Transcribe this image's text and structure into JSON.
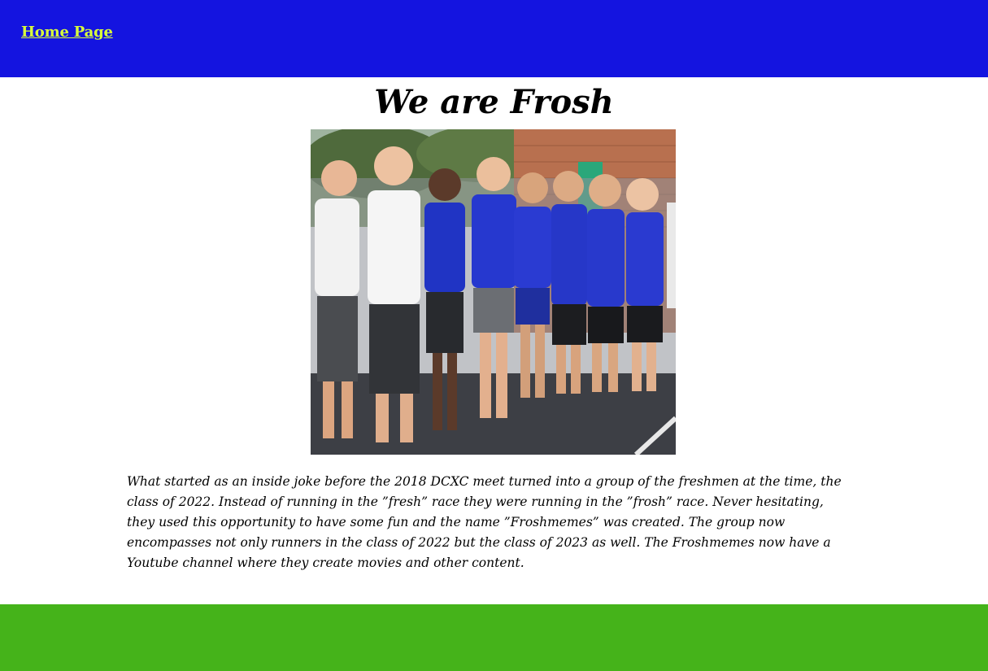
{
  "header": {
    "home_link": "Home Page"
  },
  "main": {
    "title": "We are Frosh",
    "photo_alt": "Group photo of the Froshmemes runners",
    "description": "What started as an inside joke before the 2018 DCXC meet turned into a group of the freshmen at the time, the class of 2022. Instead of running in the ”fresh” race they were running in the ”frosh” race. Never hesitating, they used this opportunity to have some fun and the name ”Froshmemes” was created. The group now encompasses not only runners in the class of 2022 but the class of 2023 as well. The Froshmemes now have a Youtube channel where they create movies and other content."
  },
  "colors": {
    "header_bg": "#1414e0",
    "link": "#d9ff3a",
    "footer_bg": "#45b31a"
  }
}
